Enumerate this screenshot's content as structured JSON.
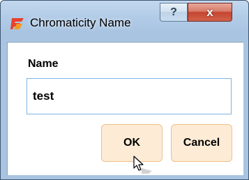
{
  "dialog": {
    "title": "Chromaticity Name",
    "help_glyph": "?",
    "close_glyph": "x",
    "icon": "app-logo-icon"
  },
  "form": {
    "label": "Name",
    "value": "test"
  },
  "buttons": {
    "ok": "OK",
    "cancel": "Cancel"
  },
  "colors": {
    "button_fill": "#fdebd6",
    "button_border": "#f0c08a",
    "input_border": "#7eb4e6",
    "frame": "#a9c4e1",
    "logo_red": "#e8412c",
    "logo_orange": "#f39a1e"
  }
}
